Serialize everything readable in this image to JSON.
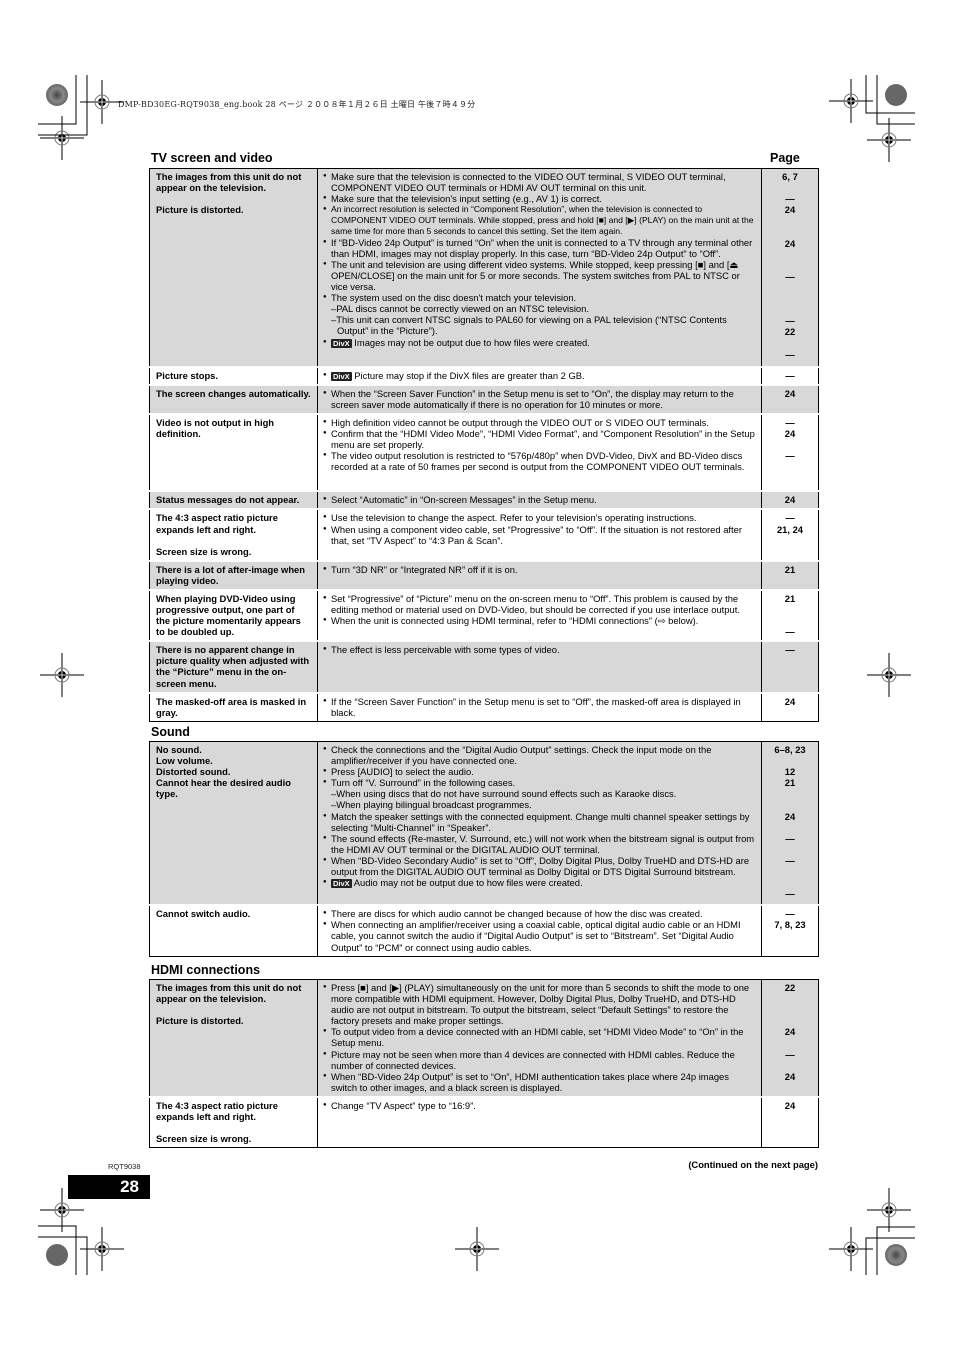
{
  "header": {
    "print_line": "DMP-BD30EG-RQT9038_eng.book  28 ページ  ２００８年１月２６日  土曜日  午後７時４９分"
  },
  "page_column_title": "Page",
  "sections": [
    {
      "title": "TV screen and video",
      "rows": [
        {
          "shade": "gray",
          "symptoms": [
            "The images from this unit do not appear on the television.",
            "Picture is distorted."
          ],
          "remedies": [
            {
              "type": "bullet",
              "text": "Make sure that the television is connected to the VIDEO OUT terminal, S VIDEO OUT terminal, COMPONENT VIDEO OUT terminals or HDMI AV OUT terminal on this unit."
            },
            {
              "type": "bullet",
              "text": "Make sure that the television's input setting (e.g., AV 1) is correct."
            },
            {
              "type": "bullet",
              "small": true,
              "text": "An incorrect resolution is selected in “Component Resolution”, when the television is connected to COMPONENT VIDEO OUT terminals. While stopped, press and hold [■] and [▶] (PLAY) on the main unit at the same time for more than 5 seconds to cancel this setting. Set the item again."
            },
            {
              "type": "bullet",
              "text": "If “BD-Video 24p Output” is turned “On” when the unit is connected to a TV through any terminal other than HDMI, images may not display properly. In this case, turn “BD-Video 24p Output” to “Off”."
            },
            {
              "type": "bullet",
              "text": "The unit and television are using different video systems. While stopped, keep pressing [■] and [⏏ OPEN/CLOSE] on the main unit for 5 or more seconds. The system switches from PAL to NTSC or vice versa."
            },
            {
              "type": "bullet",
              "text": "The system used on the disc doesn't match your television."
            },
            {
              "type": "dash",
              "text": "PAL discs cannot be correctly viewed on an NTSC television."
            },
            {
              "type": "dash",
              "text": "This unit can convert NTSC signals to PAL60 for viewing on a PAL television (“NTSC Contents Output” in the “Picture”)."
            },
            {
              "type": "bullet",
              "divx": true,
              "text": "Images may not be output due to how files were created."
            }
          ],
          "pages": [
            "6, 7",
            "",
            "—",
            "24",
            "",
            "",
            "24",
            "",
            "",
            "—",
            "",
            "",
            "",
            "—",
            "22",
            "",
            "—"
          ]
        },
        {
          "shade": "white",
          "symptoms": [
            "Picture stops."
          ],
          "remedies": [
            {
              "type": "bullet",
              "divx": true,
              "text": "Picture may stop if the DivX files are greater than 2 GB."
            }
          ],
          "pages": [
            "—"
          ]
        },
        {
          "shade": "gray",
          "symptoms": [
            "The screen changes automatically."
          ],
          "remedies": [
            {
              "type": "bullet",
              "text": "When the “Screen Saver Function” in the Setup menu is set to “On”, the display may return to the screen saver mode automatically if there is no operation for 10 minutes or more."
            }
          ],
          "pages": [
            "24"
          ]
        },
        {
          "shade": "white",
          "symptoms": [
            "Video is not output in high definition."
          ],
          "remedies": [
            {
              "type": "bullet",
              "text": "High definition video cannot be output through the VIDEO OUT or S VIDEO OUT terminals."
            },
            {
              "type": "bullet",
              "text": "Confirm that the “HDMI Video Mode”, “HDMI Video Format”, and “Component Resolution” in the Setup menu are set properly."
            },
            {
              "type": "bullet",
              "text": "The video output resolution is restricted to “576p/480p” when DVD-Video, DivX and BD-Video discs recorded at a rate of 50 frames per second is output from the COMPONENT VIDEO OUT terminals."
            }
          ],
          "pages": [
            "—",
            "24",
            "",
            "—"
          ]
        },
        {
          "shade": "gray",
          "symptoms": [
            "Status messages do not appear."
          ],
          "remedies": [
            {
              "type": "bullet",
              "text": "Select “Automatic” in “On-screen Messages” in the Setup menu."
            }
          ],
          "pages": [
            "24"
          ]
        },
        {
          "shade": "white",
          "symptoms": [
            "The 4:3 aspect ratio picture expands left and right.",
            "Screen size is wrong."
          ],
          "remedies": [
            {
              "type": "bullet",
              "text": "Use the television to change the aspect. Refer to your television's operating instructions."
            },
            {
              "type": "bullet",
              "text": "When using a component video cable, set “Progressive” to “Off”. If the situation is not restored after that, set “TV Aspect” to “4:3 Pan & Scan”."
            }
          ],
          "pages": [
            "—",
            "21, 24"
          ]
        },
        {
          "shade": "gray",
          "symptoms": [
            "There is a lot of after-image when playing video."
          ],
          "remedies": [
            {
              "type": "bullet",
              "text": "Turn “3D NR” or “Integrated NR” off if it is on."
            }
          ],
          "pages": [
            "21"
          ]
        },
        {
          "shade": "white",
          "symptoms": [
            "When playing DVD-Video using progressive output, one part of the picture momentarily appears to be doubled up."
          ],
          "remedies": [
            {
              "type": "bullet",
              "text": "Set “Progressive” of “Picture” menu on the on-screen menu to “Off”. This problem is caused by the editing method or material used on DVD-Video, but should be corrected if you use interlace output."
            },
            {
              "type": "bullet",
              "text": "When the unit is connected using HDMI terminal, refer to “HDMI connections” (⇨ below)."
            }
          ],
          "pages": [
            "21",
            "",
            "",
            "—"
          ]
        },
        {
          "shade": "gray",
          "symptoms": [
            "There is no apparent change in picture quality when adjusted with the “Picture” menu in the on-screen menu."
          ],
          "remedies": [
            {
              "type": "bullet",
              "text": "The effect is less perceivable with some types of video."
            }
          ],
          "pages": [
            "—"
          ]
        },
        {
          "shade": "white",
          "symptoms": [
            "The masked-off area is masked in gray."
          ],
          "remedies": [
            {
              "type": "bullet",
              "text": "If the “Screen Saver Function” in the Setup menu is set to “Off”, the masked-off area is displayed in black."
            }
          ],
          "pages": [
            "24"
          ]
        }
      ]
    },
    {
      "title": "Sound",
      "rows": [
        {
          "shade": "gray",
          "symptoms": [
            "No sound.<br>Low volume.<br>Distorted sound.<br>Cannot hear the desired audio type."
          ],
          "symptom_lines": [
            "No sound.",
            "Low volume.",
            "Distorted sound.",
            "Cannot hear the desired audio type."
          ],
          "remedies": [
            {
              "type": "bullet",
              "text": "Check the connections and the “Digital Audio Output” settings. Check the input mode on the amplifier/receiver if you have connected one."
            },
            {
              "type": "bullet",
              "text": "Press [AUDIO] to select the audio."
            },
            {
              "type": "bullet",
              "text": "Turn off “V. Surround” in the following cases."
            },
            {
              "type": "dash",
              "text": "When using discs that do not have surround sound effects such as Karaoke discs."
            },
            {
              "type": "dash",
              "text": "When playing bilingual broadcast programmes."
            },
            {
              "type": "bullet",
              "text": "Match the speaker settings with the connected equipment. Change multi channel speaker settings by selecting “Multi-Channel” in “Speaker”."
            },
            {
              "type": "bullet",
              "text": "The sound effects (Re-master, V. Surround, etc.) will not work when the bitstream signal is output from the HDMI AV OUT terminal or the DIGITAL AUDIO OUT terminal."
            },
            {
              "type": "bullet",
              "text": "When “BD-Video Secondary Audio” is set to “Off”, Dolby Digital Plus, Dolby TrueHD and DTS-HD are output from the DIGITAL AUDIO OUT terminal as Dolby Digital or DTS Digital Surround bitstream."
            },
            {
              "type": "bullet",
              "divx": true,
              "text": "Audio may not be output due to how files were created."
            }
          ],
          "pages": [
            "6–8, 23",
            "",
            "12",
            "21",
            "",
            "",
            "24",
            "",
            "—",
            "",
            "—",
            "",
            "",
            "—"
          ]
        },
        {
          "shade": "white",
          "symptoms": [
            "Cannot switch audio."
          ],
          "remedies": [
            {
              "type": "bullet",
              "text": "There are discs for which audio cannot be changed because of how the disc was created."
            },
            {
              "type": "bullet",
              "text": "When connecting an amplifier/receiver using a coaxial cable, optical digital audio cable or an HDMI cable, you cannot switch the audio if “Digital Audio Output” is set to “Bitstream”. Set “Digital Audio Output” to “PCM” or connect using audio cables."
            }
          ],
          "pages": [
            "—",
            "7, 8, 23"
          ]
        }
      ]
    },
    {
      "title": "HDMI connections",
      "rows": [
        {
          "shade": "gray",
          "symptoms": [
            "The images from this unit do not appear on the television.",
            "Picture is distorted."
          ],
          "remedies": [
            {
              "type": "bullet",
              "text": "Press [■] and [▶] (PLAY) simultaneously on the unit for more than 5 seconds to shift the mode to one more compatible with HDMI equipment. However, Dolby Digital Plus, Dolby TrueHD, and DTS-HD audio are not output in bitstream. To output the bitstream, select “Default Settings” to restore the factory presets and make proper settings."
            },
            {
              "type": "bullet",
              "text": "To output video from a device connected with an HDMI cable, set “HDMI Video Mode” to “On” in the Setup menu."
            },
            {
              "type": "bullet",
              "text": "Picture may not be seen when more than 4 devices are connected with HDMI cables. Reduce the number of connected devices."
            },
            {
              "type": "bullet",
              "text": "When “BD-Video 24p Output” is set to “On”, HDMI authentication takes place where 24p images switch to other images, and a black screen is displayed."
            }
          ],
          "pages": [
            "22",
            "",
            "",
            "",
            "24",
            "",
            "—",
            "",
            "24"
          ]
        },
        {
          "shade": "white",
          "symptoms": [
            "The 4:3 aspect ratio picture expands left and right.",
            "Screen size is wrong."
          ],
          "remedies": [
            {
              "type": "bullet",
              "text": "Change “TV Aspect” type to “16:9”."
            }
          ],
          "pages": [
            "24"
          ]
        }
      ]
    }
  ],
  "divx_badge": "DivX",
  "footer": {
    "doc_code": "RQT9038",
    "continued": "(Continued on the next page)",
    "page_number": "28"
  }
}
